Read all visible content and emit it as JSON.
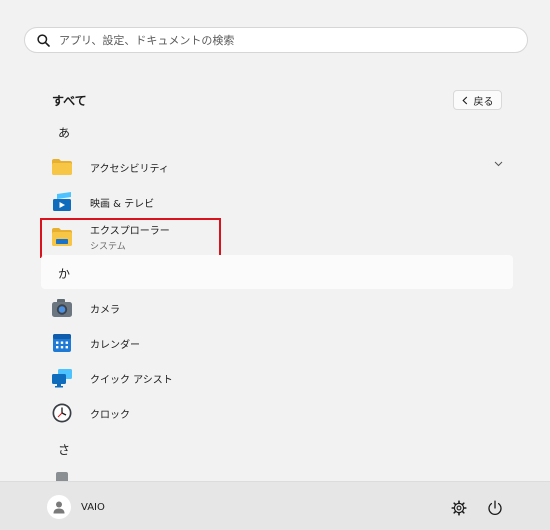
{
  "search": {
    "placeholder": "アプリ、設定、ドキュメントの検索"
  },
  "header": {
    "title": "すべて",
    "back_label": "戻る"
  },
  "sections": [
    "あ",
    "か",
    "さ"
  ],
  "apps": [
    {
      "name": "アクセシビリティ",
      "icon": "folder-icon",
      "expandable": true
    },
    {
      "name": "映画 & テレビ",
      "icon": "movies-tv-icon"
    },
    {
      "name": "エクスプローラー",
      "subtitle": "システム",
      "icon": "file-explorer-icon",
      "highlighted": true
    },
    {
      "name": "カメラ",
      "icon": "camera-icon"
    },
    {
      "name": "カレンダー",
      "icon": "calendar-icon"
    },
    {
      "name": "クイック アシスト",
      "icon": "quick-assist-icon"
    },
    {
      "name": "クロック",
      "icon": "clock-icon"
    }
  ],
  "footer": {
    "user_name": "VAIO",
    "settings_icon": "gear-icon",
    "power_icon": "power-icon"
  },
  "colors": {
    "highlight_border": "#d8131d",
    "accent_blue": "#0f6cbd",
    "folder_yellow": "#f8c646"
  }
}
